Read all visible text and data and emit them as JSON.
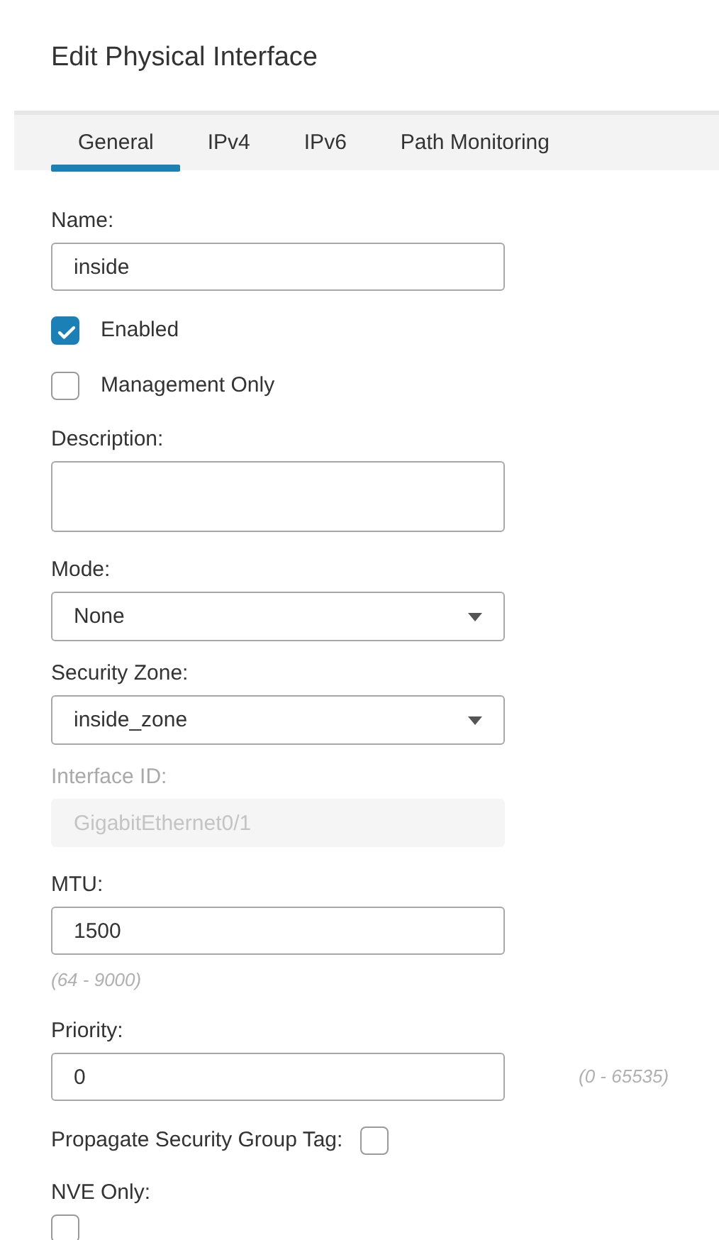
{
  "dialog": {
    "title": "Edit Physical Interface"
  },
  "tabs": [
    {
      "label": "General",
      "selected": true
    },
    {
      "label": "IPv4",
      "selected": false
    },
    {
      "label": "IPv6",
      "selected": false
    },
    {
      "label": "Path Monitoring",
      "selected": false
    }
  ],
  "fields": [
    {
      "kind": "text",
      "label": "Name:",
      "value": "inside"
    },
    {
      "kind": "checkbox",
      "label": "Enabled",
      "checked": true
    },
    {
      "kind": "checkbox",
      "label": "Management Only",
      "checked": false
    },
    {
      "kind": "textarea",
      "label": "Description:"
    },
    {
      "kind": "select",
      "label": "Mode:",
      "value": "None"
    },
    {
      "kind": "select",
      "label": "Security Zone:",
      "value": "inside_zone"
    },
    {
      "kind": "readonly",
      "label": "Interface ID:",
      "value": "GigabitEthernet0/1",
      "disabled": true
    },
    {
      "kind": "text",
      "label": "MTU:",
      "value": "1500",
      "hint": "(64 - 9000)"
    },
    {
      "kind": "text",
      "label": "Priority:",
      "value": "0",
      "side_hint": "(0 - 65535)"
    },
    {
      "kind": "inline-checkbox",
      "label": "Propagate Security Group Tag:",
      "checked": false
    },
    {
      "kind": "below-checkbox",
      "label": "NVE Only:",
      "checked": false
    }
  ]
}
